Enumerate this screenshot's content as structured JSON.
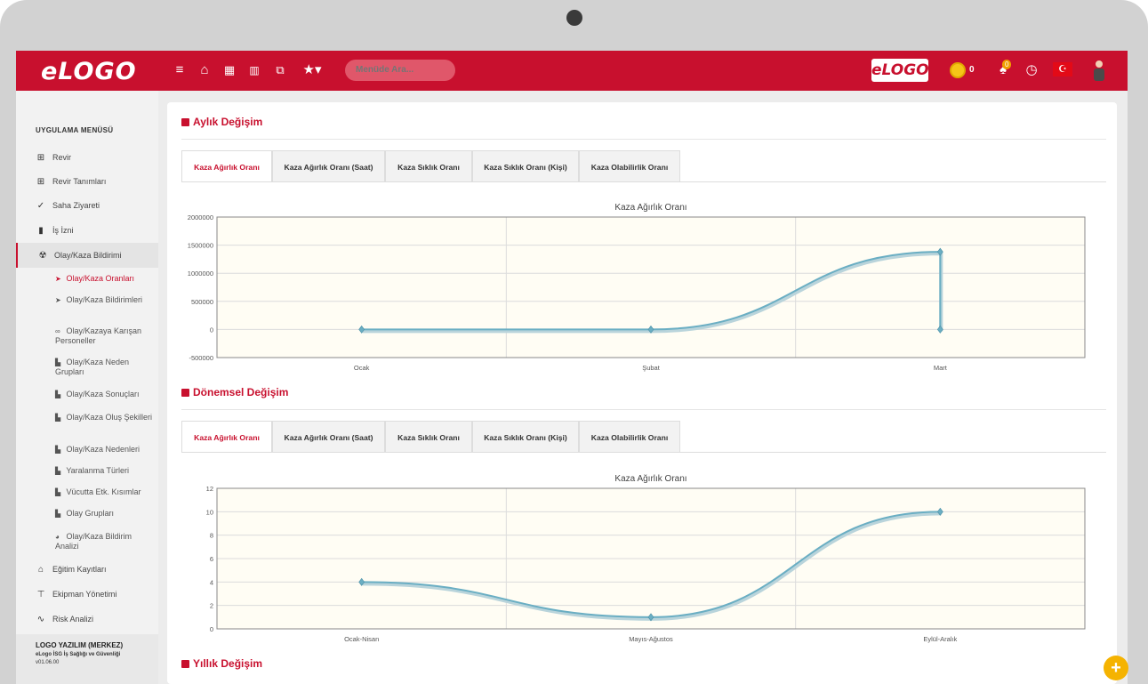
{
  "topbar": {
    "brand": "eLOGO",
    "search_placeholder": "Menüde Ara...",
    "logo_badge": "eLOGO",
    "coin_count": "0",
    "notification_count": "0",
    "flag_glyph": "☪",
    "icons": [
      "menu-icon",
      "home-icon",
      "calendar-icon",
      "bar-chart-icon",
      "copy-icon",
      "star-icon",
      "coins-icon",
      "bell-icon",
      "clock-icon",
      "flag-icon",
      "user-avatar-icon"
    ]
  },
  "sidebar": {
    "title": "UYGULAMA MENÜSÜ",
    "items": [
      {
        "label": "Revir",
        "icon": "plus-box-icon",
        "glyph": "⊞"
      },
      {
        "label": "Revir Tanımları",
        "icon": "plus-box-icon",
        "glyph": "⊞"
      },
      {
        "label": "Saha Ziyareti",
        "icon": "double-check-icon",
        "glyph": "✓"
      },
      {
        "label": "İş İzni",
        "icon": "document-icon",
        "glyph": "▮"
      },
      {
        "label": "Olay/Kaza Bildirimi",
        "icon": "hazard-icon",
        "glyph": "☢"
      }
    ],
    "sub_items": [
      {
        "label": "Olay/Kaza Oranları",
        "icon": "arrow-icon",
        "glyph": "➤"
      },
      {
        "label": "Olay/Kaza Bildirimleri",
        "icon": "arrow-icon",
        "glyph": "➤"
      },
      {
        "label": "Olay/Kazaya Karışan Personeller",
        "icon": "link-icon",
        "glyph": "∞"
      },
      {
        "label": "Olay/Kaza Neden Grupları",
        "icon": "folder-icon",
        "glyph": "▙"
      },
      {
        "label": "Olay/Kaza Sonuçları",
        "icon": "folder-icon",
        "glyph": "▙"
      },
      {
        "label": "Olay/Kaza Oluş Şekilleri",
        "icon": "folder-icon",
        "glyph": "▙"
      },
      {
        "label": "Olay/Kaza Nedenleri",
        "icon": "folder-icon",
        "glyph": "▙"
      },
      {
        "label": "Yaralanma Türleri",
        "icon": "folder-icon",
        "glyph": "▙"
      },
      {
        "label": "Vücutta Etk. Kısımlar",
        "icon": "folder-icon",
        "glyph": "▙"
      },
      {
        "label": "Olay Grupları",
        "icon": "folder-icon",
        "glyph": "▙"
      },
      {
        "label": "Olay/Kaza Bildirim Analizi",
        "icon": "pie-chart-icon",
        "glyph": "◕"
      }
    ],
    "bottom_items": [
      {
        "label": "Eğitim Kayıtları",
        "icon": "institution-icon",
        "glyph": "⌂"
      },
      {
        "label": "Ekipman Yönetimi",
        "icon": "paint-roller-icon",
        "glyph": "⊤"
      },
      {
        "label": "Risk Analizi",
        "icon": "pulse-icon",
        "glyph": "∿"
      }
    ],
    "footer": {
      "company": "LOGO YAZILIM (MERKEZ)",
      "product": "eLogo İSG İş Sağlığı ve Güvenliği",
      "version": "v01.06.00"
    }
  },
  "sections": {
    "monthly": "Aylık Değişim",
    "periodic": "Dönemsel Değişim",
    "yearly": "Yıllık Değişim"
  },
  "tabs": [
    "Kaza Ağırlık Oranı",
    "Kaza Ağırlık Oranı (Saat)",
    "Kaza Sıklık Oranı",
    "Kaza Sıklık Oranı (Kişi)",
    "Kaza Olabilirlik Oranı"
  ],
  "fab_glyph": "+",
  "chart_data": [
    {
      "type": "line",
      "title": "Kaza Ağırlık Oranı",
      "categories": [
        "Ocak",
        "Şubat",
        "Mart"
      ],
      "points": [
        {
          "x": "Ocak",
          "y": 0
        },
        {
          "x": "Şubat",
          "y": 0
        },
        {
          "x": "Mart",
          "y": 1380000
        },
        {
          "x": "Mart",
          "y": 0
        }
      ],
      "ylim": [
        -500000,
        2000000
      ],
      "yticks": [
        -500000,
        0,
        500000,
        1000000,
        1500000,
        2000000
      ],
      "grid": true,
      "color": "#6aaec3",
      "background": "#fffdf4"
    },
    {
      "type": "line",
      "title": "Kaza Ağırlık Oranı",
      "categories": [
        "Ocak-Nisan",
        "Mayıs-Ağustos",
        "Eylül-Aralık"
      ],
      "points": [
        {
          "x": "Ocak-Nisan",
          "y": 4
        },
        {
          "x": "Mayıs-Ağustos",
          "y": 1
        },
        {
          "x": "Eylül-Aralık",
          "y": 10
        }
      ],
      "ylim": [
        0,
        12
      ],
      "yticks": [
        0,
        2,
        4,
        6,
        8,
        10,
        12
      ],
      "grid": true,
      "color": "#6aaec3",
      "background": "#fffdf4"
    }
  ]
}
